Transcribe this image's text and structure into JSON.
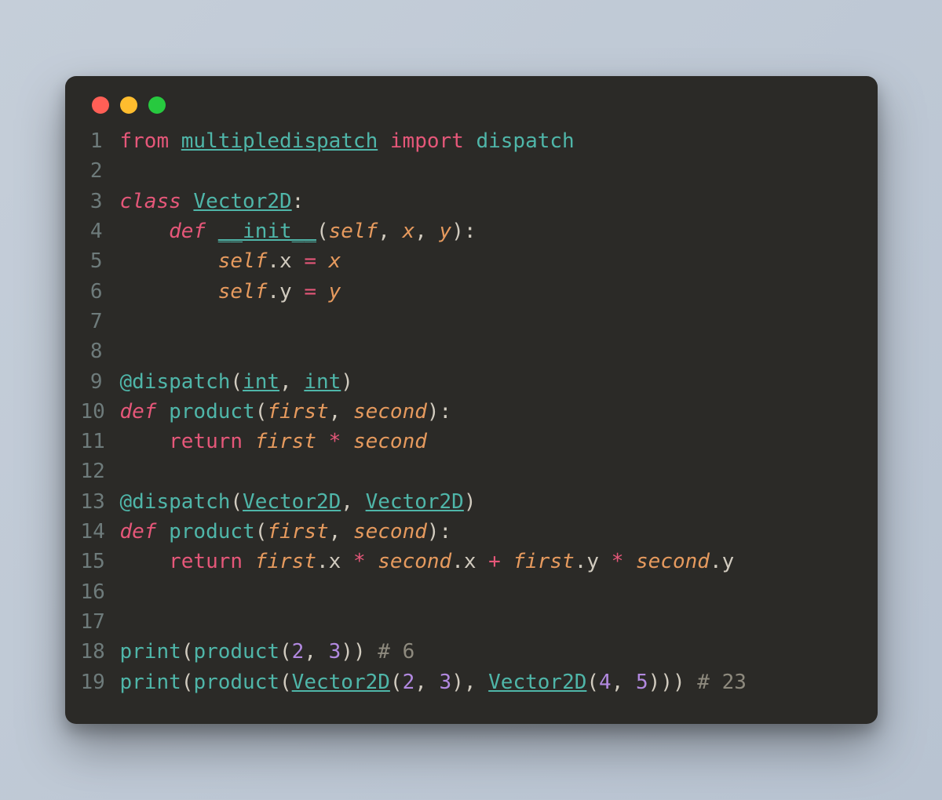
{
  "window": {
    "traffic_lights": [
      "close",
      "minimize",
      "maximize"
    ]
  },
  "code": {
    "lines": [
      {
        "n": 1,
        "tokens": [
          {
            "t": "from ",
            "c": "kw"
          },
          {
            "t": "multipledispatch",
            "c": "mod"
          },
          {
            "t": " import ",
            "c": "kw"
          },
          {
            "t": "dispatch",
            "c": "func"
          }
        ]
      },
      {
        "n": 2,
        "tokens": []
      },
      {
        "n": 3,
        "tokens": [
          {
            "t": "class ",
            "c": "kw-it"
          },
          {
            "t": "Vector2D",
            "c": "cls"
          },
          {
            "t": ":",
            "c": "punct"
          }
        ]
      },
      {
        "n": 4,
        "tokens": [
          {
            "t": "    ",
            "c": "punct"
          },
          {
            "t": "def ",
            "c": "kw-it"
          },
          {
            "t": "__init__",
            "c": "fund"
          },
          {
            "t": "(",
            "c": "punct"
          },
          {
            "t": "self",
            "c": "self"
          },
          {
            "t": ", ",
            "c": "punct"
          },
          {
            "t": "x",
            "c": "param"
          },
          {
            "t": ", ",
            "c": "punct"
          },
          {
            "t": "y",
            "c": "param"
          },
          {
            "t": "):",
            "c": "punct"
          }
        ]
      },
      {
        "n": 5,
        "tokens": [
          {
            "t": "        ",
            "c": "punct"
          },
          {
            "t": "self",
            "c": "self"
          },
          {
            "t": ".x ",
            "c": "prop"
          },
          {
            "t": "= ",
            "c": "op"
          },
          {
            "t": "x",
            "c": "param"
          }
        ]
      },
      {
        "n": 6,
        "tokens": [
          {
            "t": "        ",
            "c": "punct"
          },
          {
            "t": "self",
            "c": "self"
          },
          {
            "t": ".y ",
            "c": "prop"
          },
          {
            "t": "= ",
            "c": "op"
          },
          {
            "t": "y",
            "c": "param"
          }
        ]
      },
      {
        "n": 7,
        "tokens": []
      },
      {
        "n": 8,
        "tokens": []
      },
      {
        "n": 9,
        "tokens": [
          {
            "t": "@dispatch",
            "c": "deco"
          },
          {
            "t": "(",
            "c": "punct"
          },
          {
            "t": "int",
            "c": "cls"
          },
          {
            "t": ", ",
            "c": "punct"
          },
          {
            "t": "int",
            "c": "cls"
          },
          {
            "t": ")",
            "c": "punct"
          }
        ]
      },
      {
        "n": 10,
        "tokens": [
          {
            "t": "def ",
            "c": "kw-it"
          },
          {
            "t": "product",
            "c": "name"
          },
          {
            "t": "(",
            "c": "punct"
          },
          {
            "t": "first",
            "c": "param"
          },
          {
            "t": ", ",
            "c": "punct"
          },
          {
            "t": "second",
            "c": "param"
          },
          {
            "t": "):",
            "c": "punct"
          }
        ]
      },
      {
        "n": 11,
        "tokens": [
          {
            "t": "    ",
            "c": "punct"
          },
          {
            "t": "return ",
            "c": "kw"
          },
          {
            "t": "first",
            "c": "param"
          },
          {
            "t": " * ",
            "c": "op"
          },
          {
            "t": "second",
            "c": "param"
          }
        ]
      },
      {
        "n": 12,
        "tokens": []
      },
      {
        "n": 13,
        "tokens": [
          {
            "t": "@dispatch",
            "c": "deco"
          },
          {
            "t": "(",
            "c": "punct"
          },
          {
            "t": "Vector2D",
            "c": "cls"
          },
          {
            "t": ", ",
            "c": "punct"
          },
          {
            "t": "Vector2D",
            "c": "cls"
          },
          {
            "t": ")",
            "c": "punct"
          }
        ]
      },
      {
        "n": 14,
        "tokens": [
          {
            "t": "def ",
            "c": "kw-it"
          },
          {
            "t": "product",
            "c": "name"
          },
          {
            "t": "(",
            "c": "punct"
          },
          {
            "t": "first",
            "c": "param"
          },
          {
            "t": ", ",
            "c": "punct"
          },
          {
            "t": "second",
            "c": "param"
          },
          {
            "t": "):",
            "c": "punct"
          }
        ]
      },
      {
        "n": 15,
        "tokens": [
          {
            "t": "    ",
            "c": "punct"
          },
          {
            "t": "return ",
            "c": "kw"
          },
          {
            "t": "first",
            "c": "param"
          },
          {
            "t": ".x ",
            "c": "prop"
          },
          {
            "t": "* ",
            "c": "op"
          },
          {
            "t": "second",
            "c": "param"
          },
          {
            "t": ".x ",
            "c": "prop"
          },
          {
            "t": "+ ",
            "c": "op"
          },
          {
            "t": "first",
            "c": "param"
          },
          {
            "t": ".y ",
            "c": "prop"
          },
          {
            "t": "* ",
            "c": "op"
          },
          {
            "t": "second",
            "c": "param"
          },
          {
            "t": ".y",
            "c": "prop"
          }
        ]
      },
      {
        "n": 16,
        "tokens": []
      },
      {
        "n": 17,
        "tokens": []
      },
      {
        "n": 18,
        "tokens": [
          {
            "t": "print",
            "c": "name"
          },
          {
            "t": "(",
            "c": "punct"
          },
          {
            "t": "product",
            "c": "name"
          },
          {
            "t": "(",
            "c": "punct"
          },
          {
            "t": "2",
            "c": "num"
          },
          {
            "t": ", ",
            "c": "punct"
          },
          {
            "t": "3",
            "c": "num"
          },
          {
            "t": ")) ",
            "c": "punct"
          },
          {
            "t": "# 6",
            "c": "comm"
          }
        ]
      },
      {
        "n": 19,
        "tokens": [
          {
            "t": "print",
            "c": "name"
          },
          {
            "t": "(",
            "c": "punct"
          },
          {
            "t": "product",
            "c": "name"
          },
          {
            "t": "(",
            "c": "punct"
          },
          {
            "t": "Vector2D",
            "c": "cls"
          },
          {
            "t": "(",
            "c": "punct"
          },
          {
            "t": "2",
            "c": "num"
          },
          {
            "t": ", ",
            "c": "punct"
          },
          {
            "t": "3",
            "c": "num"
          },
          {
            "t": "), ",
            "c": "punct"
          },
          {
            "t": "Vector2D",
            "c": "cls"
          },
          {
            "t": "(",
            "c": "punct"
          },
          {
            "t": "4",
            "c": "num"
          },
          {
            "t": ", ",
            "c": "punct"
          },
          {
            "t": "5",
            "c": "num"
          },
          {
            "t": "))) ",
            "c": "punct"
          },
          {
            "t": "# 23",
            "c": "comm"
          }
        ]
      }
    ]
  }
}
